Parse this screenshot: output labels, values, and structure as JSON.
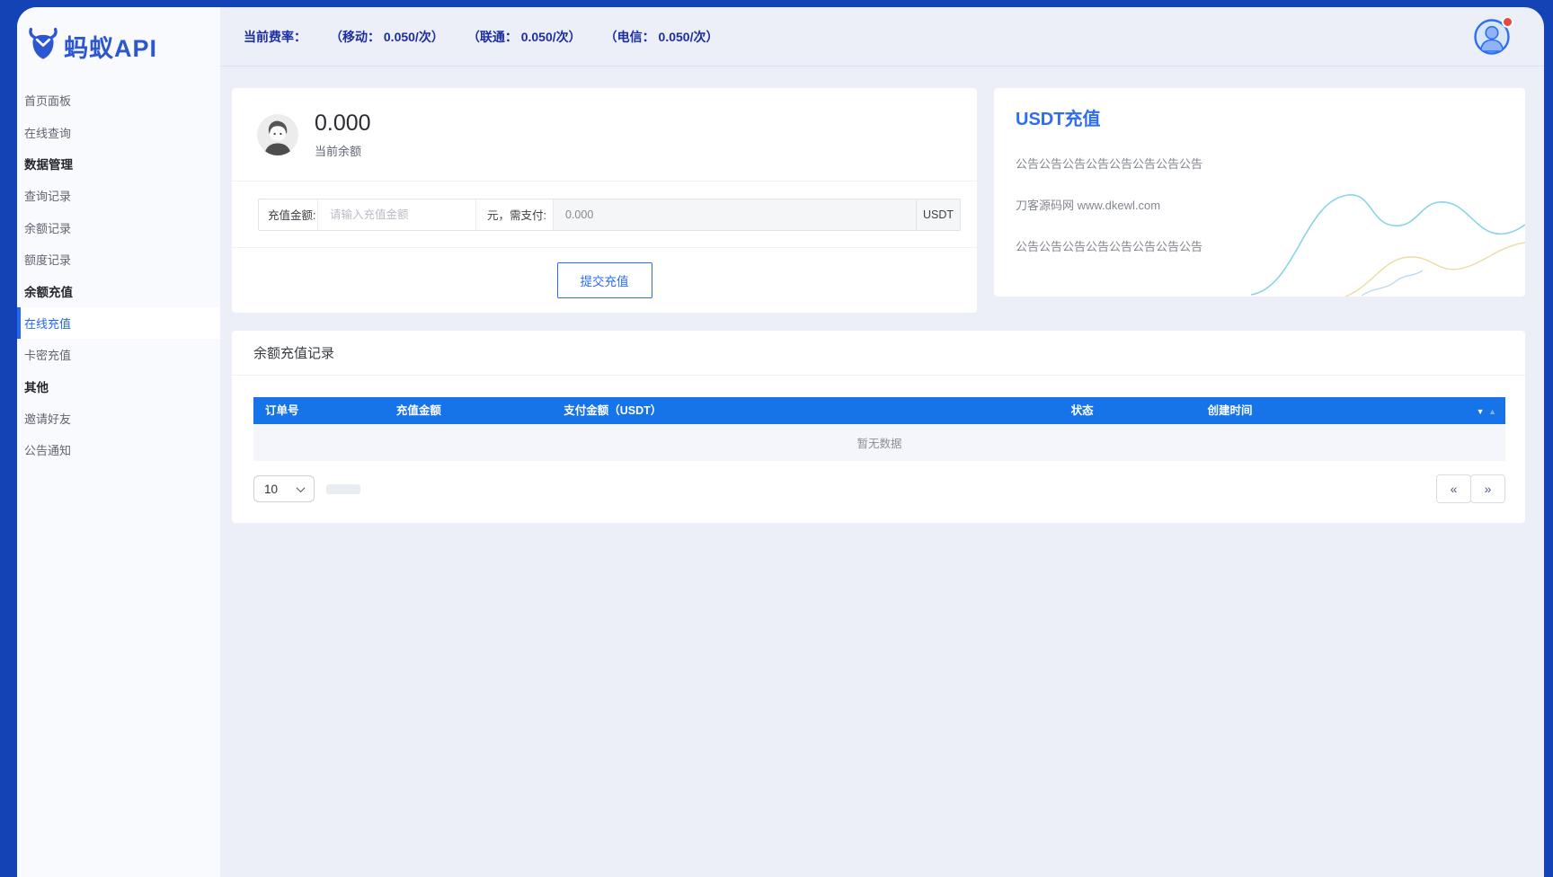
{
  "brand": {
    "name": "蚂蚁API"
  },
  "topbar": {
    "fee_label": "当前费率：",
    "rates": [
      "（移动： 0.050/次）",
      "（联通： 0.050/次）",
      "（电信： 0.050/次）"
    ]
  },
  "sidebar": {
    "items": [
      {
        "label": "首页面板",
        "type": "item"
      },
      {
        "label": "在线查询",
        "type": "item"
      },
      {
        "label": "数据管理",
        "type": "section"
      },
      {
        "label": "查询记录",
        "type": "item"
      },
      {
        "label": "余额记录",
        "type": "item"
      },
      {
        "label": "额度记录",
        "type": "item"
      },
      {
        "label": "余额充值",
        "type": "section"
      },
      {
        "label": "在线充值",
        "type": "item",
        "active": true
      },
      {
        "label": "卡密充值",
        "type": "item"
      },
      {
        "label": "其他",
        "type": "section"
      },
      {
        "label": "邀请好友",
        "type": "item"
      },
      {
        "label": "公告通知",
        "type": "item"
      }
    ]
  },
  "balance_card": {
    "amount": "0.000",
    "amount_label": "当前余额",
    "form": {
      "amount_label": "充值金额:",
      "amount_placeholder": "请输入充值金额",
      "pay_label": "元，需支付:",
      "pay_value": "0.000",
      "currency": "USDT"
    },
    "submit_label": "提交充值"
  },
  "usdt_card": {
    "title": "USDT充值",
    "lines": [
      "公告公告公告公告公告公告公告公告",
      "刀客源码网 www.dkewl.com",
      "公告公告公告公告公告公告公告公告"
    ]
  },
  "records_card": {
    "title": "余额充值记录",
    "table": {
      "columns": [
        "订单号",
        "充值金额",
        "支付金额（USDT）",
        "状态",
        "创建时间"
      ],
      "empty_text": "暂无数据"
    },
    "pagination": {
      "page_size": "10",
      "prev_icon": "«",
      "next_icon": "»"
    }
  },
  "icons": {
    "sort_desc": "▼",
    "sort_asc": "▲"
  },
  "colors": {
    "frame_blue": "#1343b4",
    "accent_blue": "#2468f2",
    "table_header_blue": "#1674e8",
    "topbar_text_blue": "#1b2f9e",
    "notification_red": "#e8473f",
    "main_background": "#edeff8"
  }
}
